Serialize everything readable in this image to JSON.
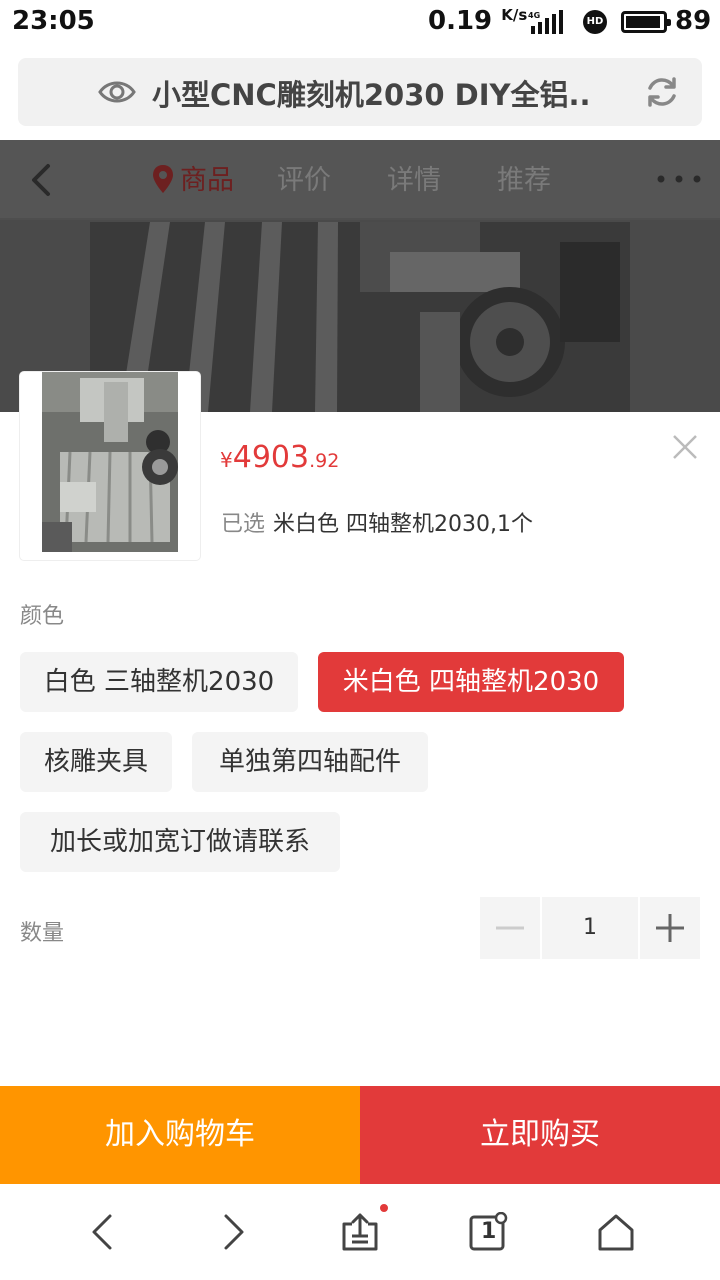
{
  "status_bar": {
    "time": "23:05",
    "net_speed": "0.19",
    "net_unit": "K/s",
    "network": "4G",
    "hd_badge": "HD",
    "battery": "89"
  },
  "url_bar": {
    "title": "小型CNC雕刻机2030 DIY全铝.."
  },
  "product_nav": {
    "tabs": [
      {
        "label": "商品",
        "active": true
      },
      {
        "label": "评价",
        "active": false
      },
      {
        "label": "详情",
        "active": false
      },
      {
        "label": "推荐",
        "active": false
      }
    ]
  },
  "sku_sheet": {
    "price_currency": "¥",
    "price_int": "4903",
    "price_dec": ".92",
    "selected_label": "已选",
    "selected_value": "米白色 四轴整机2030,1个",
    "color_section_label": "颜色",
    "options": [
      {
        "label": "白色 三轴整机2030",
        "selected": false
      },
      {
        "label": "米白色 四轴整机2030",
        "selected": true
      },
      {
        "label": "核雕夹具",
        "selected": false
      },
      {
        "label": "单独第四轴配件",
        "selected": false
      },
      {
        "label": "加长或加宽订做请联系",
        "selected": false
      }
    ],
    "quantity_label": "数量",
    "quantity_value": "1"
  },
  "actions": {
    "add_to_cart": "加入购物车",
    "buy_now": "立即购买"
  },
  "browser_bar": {
    "tab_count": "1"
  },
  "colors": {
    "accent_red": "#e23a3a",
    "cart_orange": "#ff9500"
  }
}
